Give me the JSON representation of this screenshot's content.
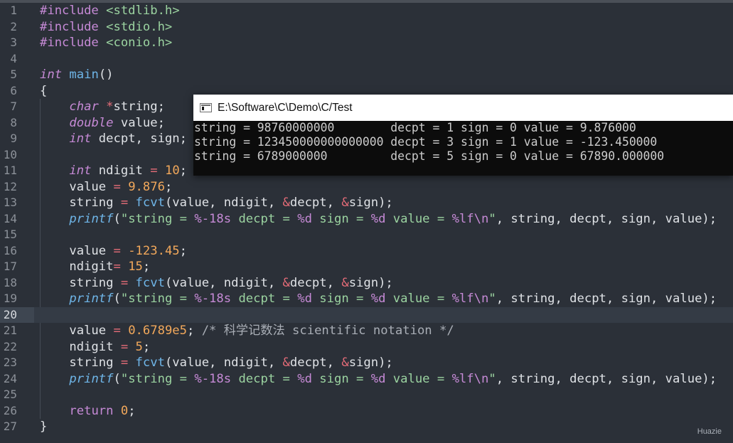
{
  "editor": {
    "current_line": 20,
    "lines": [
      {
        "n": "1",
        "tokens": [
          {
            "t": "#include ",
            "c": "pp"
          },
          {
            "t": "<stdlib.h>",
            "c": "inc"
          }
        ]
      },
      {
        "n": "2",
        "tokens": [
          {
            "t": "#include ",
            "c": "pp"
          },
          {
            "t": "<stdio.h>",
            "c": "inc"
          }
        ]
      },
      {
        "n": "3",
        "tokens": [
          {
            "t": "#include ",
            "c": "pp"
          },
          {
            "t": "<conio.h>",
            "c": "inc"
          }
        ]
      },
      {
        "n": "4",
        "tokens": []
      },
      {
        "n": "5",
        "tokens": [
          {
            "t": "int",
            "c": "ty"
          },
          {
            "t": " ",
            "c": "plain"
          },
          {
            "t": "main",
            "c": "fn"
          },
          {
            "t": "()",
            "c": "plain"
          }
        ]
      },
      {
        "n": "6",
        "tokens": [
          {
            "t": "{",
            "c": "plain"
          }
        ]
      },
      {
        "n": "7",
        "tokens": [
          {
            "t": "    ",
            "c": "plain"
          },
          {
            "t": "char",
            "c": "ty"
          },
          {
            "t": " ",
            "c": "plain"
          },
          {
            "t": "*",
            "c": "op"
          },
          {
            "t": "string;",
            "c": "plain"
          }
        ]
      },
      {
        "n": "8",
        "tokens": [
          {
            "t": "    ",
            "c": "plain"
          },
          {
            "t": "double",
            "c": "ty"
          },
          {
            "t": " value;",
            "c": "plain"
          }
        ]
      },
      {
        "n": "9",
        "tokens": [
          {
            "t": "    ",
            "c": "plain"
          },
          {
            "t": "int",
            "c": "ty"
          },
          {
            "t": " decpt, sign;",
            "c": "plain"
          }
        ]
      },
      {
        "n": "10",
        "tokens": []
      },
      {
        "n": "11",
        "tokens": [
          {
            "t": "    ",
            "c": "plain"
          },
          {
            "t": "int",
            "c": "ty"
          },
          {
            "t": " ndigit ",
            "c": "plain"
          },
          {
            "t": "=",
            "c": "op"
          },
          {
            "t": " ",
            "c": "plain"
          },
          {
            "t": "10",
            "c": "num"
          },
          {
            "t": ";",
            "c": "plain"
          }
        ]
      },
      {
        "n": "12",
        "tokens": [
          {
            "t": "    value ",
            "c": "plain"
          },
          {
            "t": "=",
            "c": "op"
          },
          {
            "t": " ",
            "c": "plain"
          },
          {
            "t": "9.876",
            "c": "num"
          },
          {
            "t": ";",
            "c": "plain"
          }
        ]
      },
      {
        "n": "13",
        "tokens": [
          {
            "t": "    string ",
            "c": "plain"
          },
          {
            "t": "=",
            "c": "op"
          },
          {
            "t": " ",
            "c": "plain"
          },
          {
            "t": "fcvt",
            "c": "fn"
          },
          {
            "t": "(value, ndigit, ",
            "c": "plain"
          },
          {
            "t": "&",
            "c": "op"
          },
          {
            "t": "decpt, ",
            "c": "plain"
          },
          {
            "t": "&",
            "c": "op"
          },
          {
            "t": "sign);",
            "c": "plain"
          }
        ]
      },
      {
        "n": "14",
        "tokens": [
          {
            "t": "    ",
            "c": "plain"
          },
          {
            "t": "printf",
            "c": "fni"
          },
          {
            "t": "(",
            "c": "plain"
          },
          {
            "t": "\"string = ",
            "c": "str"
          },
          {
            "t": "%-18s",
            "c": "fmt"
          },
          {
            "t": " decpt = ",
            "c": "str"
          },
          {
            "t": "%d",
            "c": "fmt"
          },
          {
            "t": " sign = ",
            "c": "str"
          },
          {
            "t": "%d",
            "c": "fmt"
          },
          {
            "t": " value = ",
            "c": "str"
          },
          {
            "t": "%lf",
            "c": "fmt"
          },
          {
            "t": "\\n",
            "c": "fmt"
          },
          {
            "t": "\"",
            "c": "str"
          },
          {
            "t": ", string, decpt, sign, value);",
            "c": "plain"
          }
        ]
      },
      {
        "n": "15",
        "tokens": []
      },
      {
        "n": "16",
        "tokens": [
          {
            "t": "    value ",
            "c": "plain"
          },
          {
            "t": "=",
            "c": "op"
          },
          {
            "t": " ",
            "c": "plain"
          },
          {
            "t": "-123.45",
            "c": "num"
          },
          {
            "t": ";",
            "c": "plain"
          }
        ]
      },
      {
        "n": "17",
        "tokens": [
          {
            "t": "    ndigit",
            "c": "plain"
          },
          {
            "t": "=",
            "c": "op"
          },
          {
            "t": " ",
            "c": "plain"
          },
          {
            "t": "15",
            "c": "num"
          },
          {
            "t": ";",
            "c": "plain"
          }
        ]
      },
      {
        "n": "18",
        "tokens": [
          {
            "t": "    string ",
            "c": "plain"
          },
          {
            "t": "=",
            "c": "op"
          },
          {
            "t": " ",
            "c": "plain"
          },
          {
            "t": "fcvt",
            "c": "fn"
          },
          {
            "t": "(value, ndigit, ",
            "c": "plain"
          },
          {
            "t": "&",
            "c": "op"
          },
          {
            "t": "decpt, ",
            "c": "plain"
          },
          {
            "t": "&",
            "c": "op"
          },
          {
            "t": "sign);",
            "c": "plain"
          }
        ]
      },
      {
        "n": "19",
        "tokens": [
          {
            "t": "    ",
            "c": "plain"
          },
          {
            "t": "printf",
            "c": "fni"
          },
          {
            "t": "(",
            "c": "plain"
          },
          {
            "t": "\"string = ",
            "c": "str"
          },
          {
            "t": "%-18s",
            "c": "fmt"
          },
          {
            "t": " decpt = ",
            "c": "str"
          },
          {
            "t": "%d",
            "c": "fmt"
          },
          {
            "t": " sign = ",
            "c": "str"
          },
          {
            "t": "%d",
            "c": "fmt"
          },
          {
            "t": " value = ",
            "c": "str"
          },
          {
            "t": "%lf",
            "c": "fmt"
          },
          {
            "t": "\\n",
            "c": "fmt"
          },
          {
            "t": "\"",
            "c": "str"
          },
          {
            "t": ", string, decpt, sign, value);",
            "c": "plain"
          }
        ]
      },
      {
        "n": "20",
        "tokens": []
      },
      {
        "n": "21",
        "tokens": [
          {
            "t": "    value ",
            "c": "plain"
          },
          {
            "t": "=",
            "c": "op"
          },
          {
            "t": " ",
            "c": "plain"
          },
          {
            "t": "0.6789e5",
            "c": "num"
          },
          {
            "t": "; ",
            "c": "plain"
          },
          {
            "t": "/* 科学记数法 scientific notation */",
            "c": "cm"
          }
        ]
      },
      {
        "n": "22",
        "tokens": [
          {
            "t": "    ndigit ",
            "c": "plain"
          },
          {
            "t": "=",
            "c": "op"
          },
          {
            "t": " ",
            "c": "plain"
          },
          {
            "t": "5",
            "c": "num"
          },
          {
            "t": ";",
            "c": "plain"
          }
        ]
      },
      {
        "n": "23",
        "tokens": [
          {
            "t": "    string ",
            "c": "plain"
          },
          {
            "t": "=",
            "c": "op"
          },
          {
            "t": " ",
            "c": "plain"
          },
          {
            "t": "fcvt",
            "c": "fn"
          },
          {
            "t": "(value, ndigit, ",
            "c": "plain"
          },
          {
            "t": "&",
            "c": "op"
          },
          {
            "t": "decpt, ",
            "c": "plain"
          },
          {
            "t": "&",
            "c": "op"
          },
          {
            "t": "sign);",
            "c": "plain"
          }
        ]
      },
      {
        "n": "24",
        "tokens": [
          {
            "t": "    ",
            "c": "plain"
          },
          {
            "t": "printf",
            "c": "fni"
          },
          {
            "t": "(",
            "c": "plain"
          },
          {
            "t": "\"string = ",
            "c": "str"
          },
          {
            "t": "%-18s",
            "c": "fmt"
          },
          {
            "t": " decpt = ",
            "c": "str"
          },
          {
            "t": "%d",
            "c": "fmt"
          },
          {
            "t": " sign = ",
            "c": "str"
          },
          {
            "t": "%d",
            "c": "fmt"
          },
          {
            "t": " value = ",
            "c": "str"
          },
          {
            "t": "%lf",
            "c": "fmt"
          },
          {
            "t": "\\n",
            "c": "fmt"
          },
          {
            "t": "\"",
            "c": "str"
          },
          {
            "t": ", string, decpt, sign, value);",
            "c": "plain"
          }
        ]
      },
      {
        "n": "25",
        "tokens": []
      },
      {
        "n": "26",
        "tokens": [
          {
            "t": "    ",
            "c": "plain"
          },
          {
            "t": "return",
            "c": "kw"
          },
          {
            "t": " ",
            "c": "plain"
          },
          {
            "t": "0",
            "c": "num"
          },
          {
            "t": ";",
            "c": "plain"
          }
        ]
      },
      {
        "n": "27",
        "tokens": [
          {
            "t": "}",
            "c": "plain"
          }
        ]
      }
    ]
  },
  "console": {
    "title": "E:\\Software\\C\\Demo\\C/Test",
    "output": [
      "string = 98760000000        decpt = 1 sign = 0 value = 9.876000",
      "string = 123450000000000000 decpt = 3 sign = 1 value = -123.450000",
      "string = 6789000000         decpt = 5 sign = 0 value = 67890.000000"
    ]
  },
  "watermark": "Huazie",
  "colors": {
    "background": "#2b3038",
    "keyword": "#c68ad6",
    "function": "#6fb6e9",
    "string": "#9bd3a0",
    "number": "#f2a85b",
    "operator": "#e56c78",
    "console_bg": "#0c0c0c"
  }
}
